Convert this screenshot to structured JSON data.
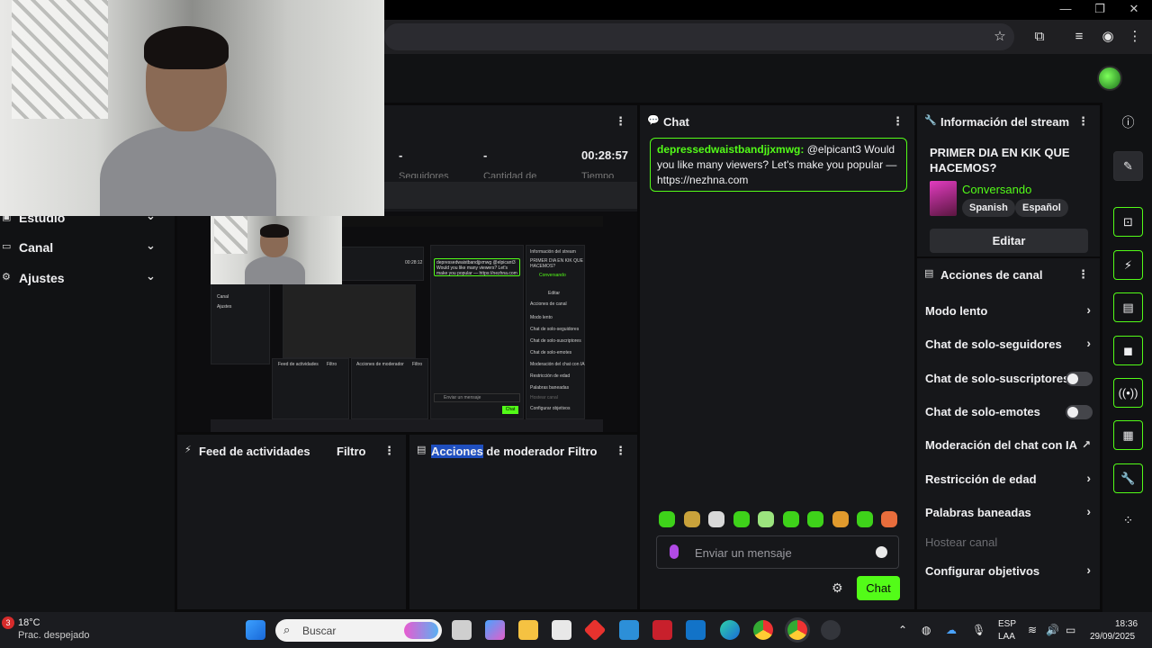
{
  "window_controls": {
    "minimize": "—",
    "maximize": "❐",
    "close": "✕"
  },
  "left_nav": {
    "items": [
      {
        "label": "Estudio",
        "icon": "studio-icon"
      },
      {
        "label": "Canal",
        "icon": "channel-icon"
      },
      {
        "label": "Ajustes",
        "icon": "settings-icon"
      }
    ]
  },
  "stats": {
    "values": [
      "-",
      "-",
      "00:28:57"
    ],
    "labels": [
      "Seguidores",
      "Cantidad de",
      "Tiempo"
    ]
  },
  "chat": {
    "title": "Chat",
    "message_user": "depressedwaistbandjjxmwg:",
    "message_text": "@elpicant3 Would you like many viewers? Let's make you popular — https://nezhna.com",
    "input_placeholder": "Enviar un mensaje",
    "send_label": "Chat"
  },
  "stream_info": {
    "title": "Información del stream",
    "stream_title": "PRIMER DIA EN KIK QUE HACEMOS?",
    "category": "Conversando",
    "tags": [
      "Spanish",
      "Español"
    ],
    "edit_label": "Editar"
  },
  "channel_actions": {
    "title": "Acciones de canal",
    "items": [
      {
        "label": "Modo lento",
        "control": "chevron"
      },
      {
        "label": "Chat de solo-seguidores",
        "control": "chevron"
      },
      {
        "label": "Chat de solo-suscriptores",
        "control": "toggle-off"
      },
      {
        "label": "Chat de solo-emotes",
        "control": "toggle-off"
      },
      {
        "label": "Moderación del chat con IA",
        "control": "external"
      },
      {
        "label": "Restricción de edad",
        "control": "chevron"
      },
      {
        "label": "Palabras baneadas",
        "control": "chevron"
      },
      {
        "label": "Hostear canal",
        "control": "disabled"
      },
      {
        "label": "Configurar objetivos",
        "control": "chevron"
      }
    ]
  },
  "activity_feed": {
    "title": "Feed de actividades",
    "filter": "Filtro"
  },
  "mod_actions": {
    "title_highlight": "Acciones",
    "title_rest": " de moderador",
    "filter": "Filtro"
  },
  "preview": {
    "chat_text": "depressedwaistbandjjxmwg @elpicant3 Would you like many viewers? Let's make you popular — https://nezhna.com",
    "info_title": "Información del stream",
    "stream_title": "PRIMER DIA EN KIK QUE HACEMOS?",
    "category": "Conversando",
    "edit": "Editar",
    "actions_title": "Acciones de canal",
    "actions": [
      "Modo lento",
      "Chat de solo-seguidores",
      "Chat de solo-suscriptores",
      "Chat de solo-emotes",
      "Moderación del chat con IA",
      "Restricción de edad",
      "Palabras baneadas",
      "Hostear canal",
      "Configurar objetivos"
    ],
    "feed": "Feed de actividades",
    "mod": "Acciones de moderador",
    "filter": "Filtro",
    "timer": "00:28:12",
    "input": "Enviar un mensaje",
    "send": "Chat",
    "nav": [
      "Canal",
      "Ajustes"
    ]
  },
  "taskbar": {
    "weather_badge": "3",
    "temperature": "18°C",
    "weather": "Prac. despejado",
    "search": "Buscar",
    "lang_top": "ESP",
    "lang_bottom": "LAA",
    "time": "18:36",
    "date": "29/09/2025"
  },
  "colors": {
    "accent": "#53fc18",
    "panel": "#16171a",
    "background": "#0a0a0b"
  }
}
